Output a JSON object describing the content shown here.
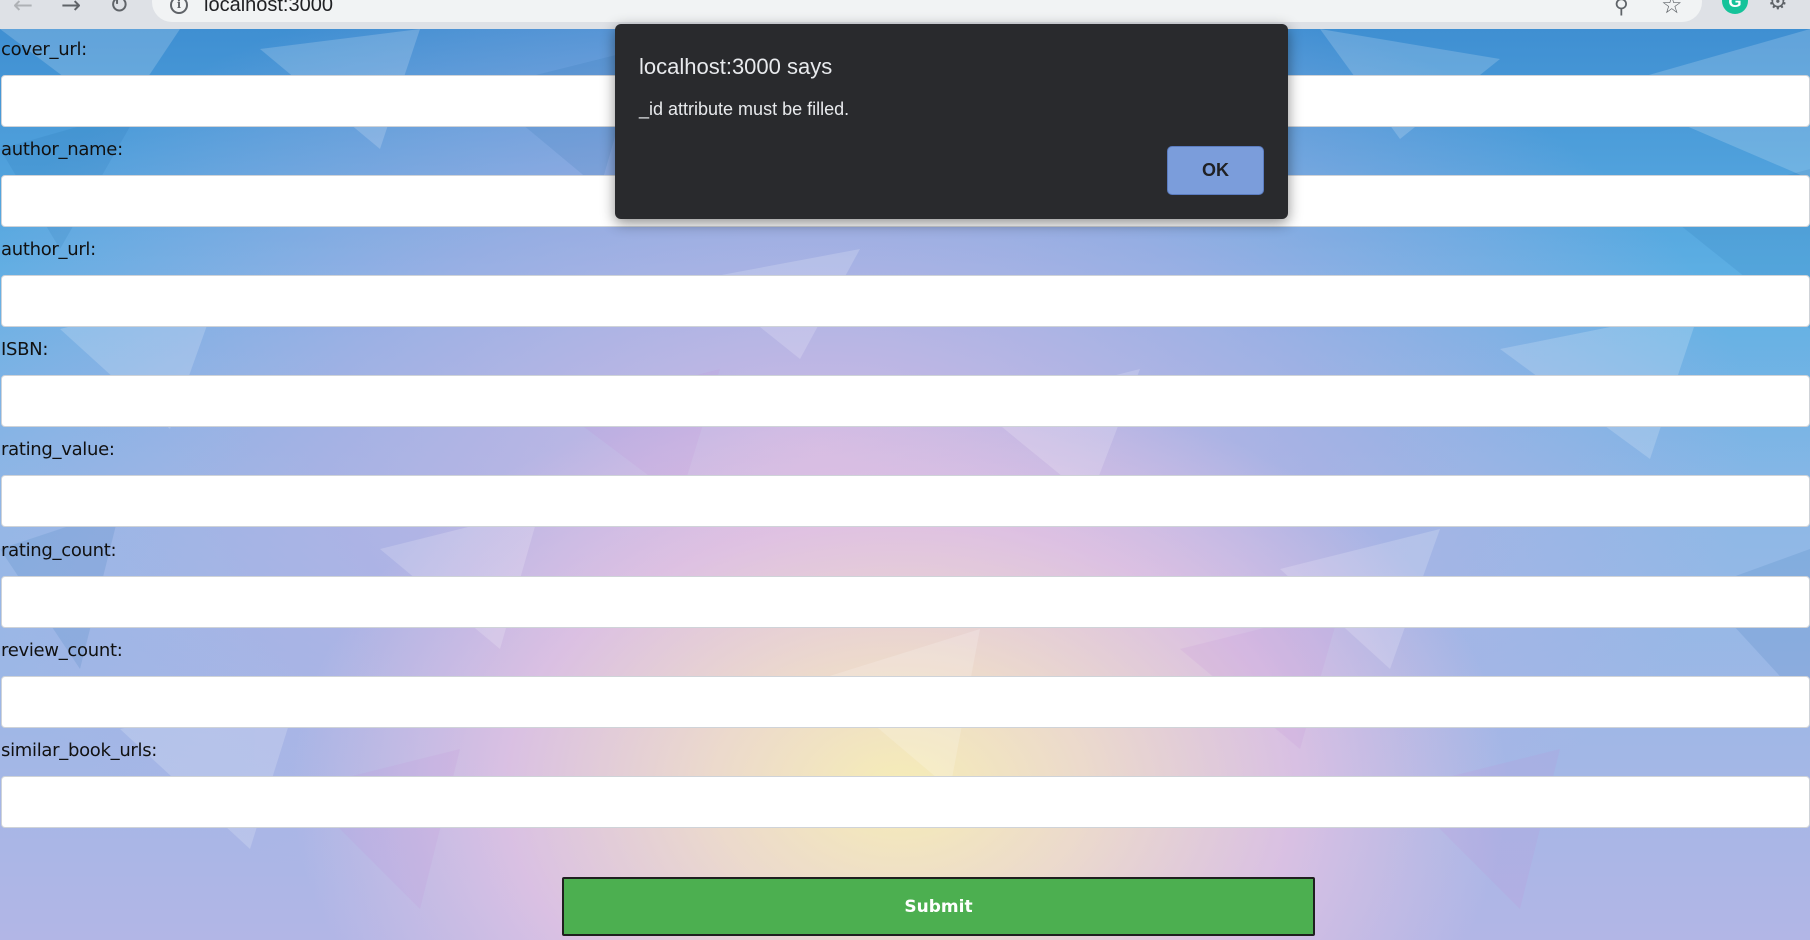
{
  "browser": {
    "url": "localhost:3000",
    "icons": {
      "back": "arrow-left-icon",
      "forward": "arrow-right-icon",
      "reload": "reload-icon",
      "site_info": "info-icon",
      "zoom": "zoom-icon",
      "bookmark": "star-icon",
      "grammarly": "grammarly-icon",
      "extensions": "puzzle-icon"
    },
    "grammarly_letter": "G"
  },
  "form": {
    "fields": [
      {
        "label": "cover_url:",
        "value": ""
      },
      {
        "label": "author_name:",
        "value": ""
      },
      {
        "label": "author_url:",
        "value": ""
      },
      {
        "label": "ISBN:",
        "value": ""
      },
      {
        "label": "rating_value:",
        "value": ""
      },
      {
        "label": "rating_count:",
        "value": ""
      },
      {
        "label": "review_count:",
        "value": ""
      },
      {
        "label": "similar_book_urls:",
        "value": ""
      }
    ],
    "submit_label": "Submit"
  },
  "dialog": {
    "title": "localhost:3000 says",
    "message": "_id attribute must be filled.",
    "ok_label": "OK"
  },
  "colors": {
    "submit_bg": "#4caf50",
    "dialog_bg": "#292a2d",
    "dialog_ok_bg": "#7b9ddb"
  }
}
